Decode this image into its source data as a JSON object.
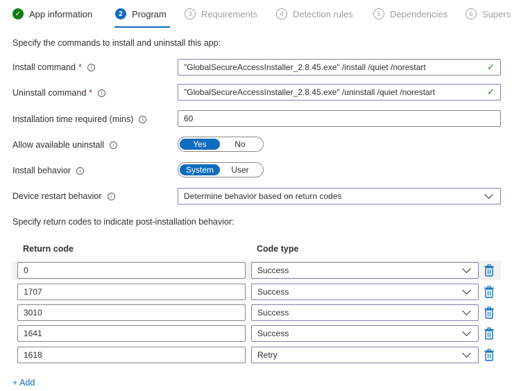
{
  "steps": [
    {
      "num": "✓",
      "label": "App information"
    },
    {
      "num": "2",
      "label": "Program"
    },
    {
      "num": "3",
      "label": "Requirements"
    },
    {
      "num": "4",
      "label": "Detection rules"
    },
    {
      "num": "5",
      "label": "Dependencies"
    },
    {
      "num": "6",
      "label": "Supers"
    }
  ],
  "form": {
    "intro": "Specify the commands to install and uninstall this app:",
    "install_label": "Install command",
    "install_value": "\"GlobalSecureAccessInstaller_2.8.45.exe\" /install /quiet /norestart",
    "uninstall_label": "Uninstall command",
    "uninstall_value": "\"GlobalSecureAccessInstaller_2.8.45.exe\" /uninstall /quiet /norestart",
    "required_mark": "*",
    "time_label": "Installation time required (mins)",
    "time_value": "60",
    "allow_uninstall_label": "Allow available uninstall",
    "allow_uninstall_options": [
      "Yes",
      "No"
    ],
    "install_behavior_label": "Install behavior",
    "install_behavior_options": [
      "System",
      "User"
    ],
    "restart_label": "Device restart behavior",
    "restart_value": "Determine behavior based on return codes"
  },
  "return_codes": {
    "intro": "Specify return codes to indicate post-installation behavior:",
    "col_code": "Return code",
    "col_type": "Code type",
    "rows": [
      {
        "code": "0",
        "type": "Success"
      },
      {
        "code": "1707",
        "type": "Success"
      },
      {
        "code": "3010",
        "type": "Success"
      },
      {
        "code": "1641",
        "type": "Success"
      },
      {
        "code": "1618",
        "type": "Retry"
      }
    ],
    "add_label": "+ Add"
  },
  "colors": {
    "accent": "#0f6cbd",
    "success": "#107c10",
    "required": "#a4262c"
  }
}
